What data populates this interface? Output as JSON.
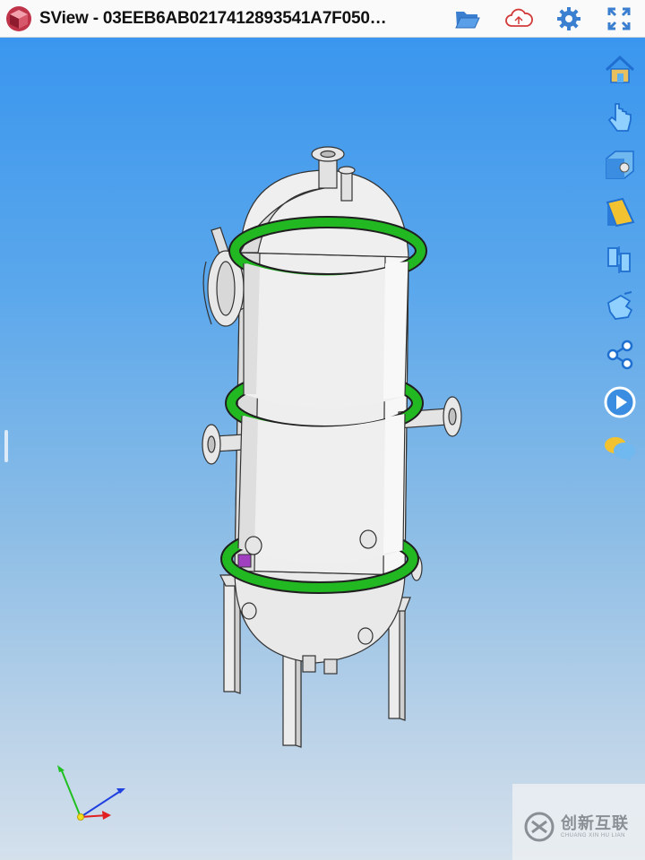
{
  "window": {
    "title": "SView - 03EEB6AB0217412893541A7F050…"
  },
  "toolbar": {
    "icons": [
      "folder-open-icon",
      "cloud-icon",
      "gear-icon",
      "fullscreen-icon"
    ]
  },
  "side_toolbar": {
    "icons": [
      "home-icon",
      "pointer-hand-icon",
      "view-cube-icon",
      "section-icon",
      "explode-icon",
      "gesture-icon",
      "share-icon",
      "play-icon",
      "comment-icon"
    ]
  },
  "axes": {
    "colors": {
      "x": "#e02020",
      "y": "#20c020",
      "z": "#2040e0"
    }
  },
  "colors": {
    "background_top": "#3a96ee",
    "background_bottom": "#d4e0ec",
    "flange_ring": "#22b822",
    "vessel": "#eeeeee"
  },
  "watermark": {
    "text": "创新互联",
    "subtext": "CHUANG XIN HU LIAN"
  }
}
